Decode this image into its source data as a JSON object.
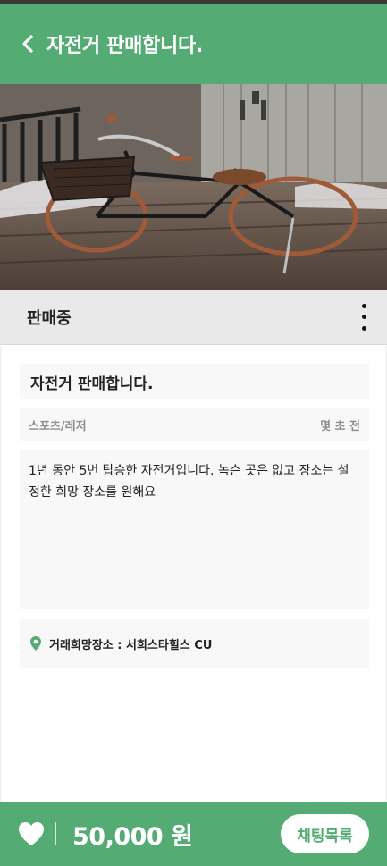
{
  "header": {
    "title": "자전거 판매합니다.",
    "back_icon": "chevron-left-icon"
  },
  "photo": {
    "description_icon": "bicycle-photo"
  },
  "status": {
    "label": "판매중",
    "more_icon": "more-vertical-icon"
  },
  "post": {
    "title": "자전거 판매합니다.",
    "category": "스포츠/레저",
    "time": "몇 초 전",
    "description": "1년 동안 5번 탑승한 자전거입니다. 녹슨 곳은 없고 장소는 설정한 희망 장소를 원해요",
    "location": "거래희망장소 : 서희스타힐스 CU",
    "location_icon": "map-pin-icon"
  },
  "footer": {
    "price": "50,000 원",
    "chat_label": "채팅목록",
    "heart_icon": "heart-icon"
  },
  "colors": {
    "accent": "#55ab74",
    "status_bg": "#e9e9e9",
    "card_bg": "#f8f8f8",
    "muted": "#8c8c8c"
  }
}
